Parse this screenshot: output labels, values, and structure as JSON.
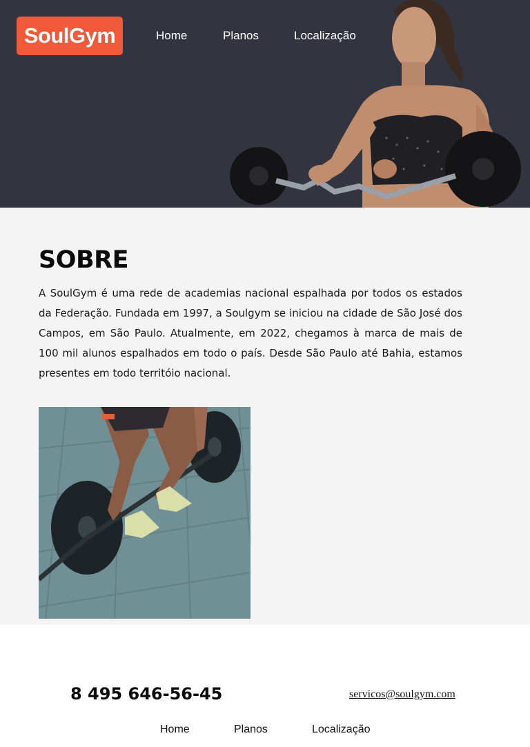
{
  "brand": {
    "logo_text": "SoulGym",
    "accent_color": "#f05a3a",
    "header_bg": "#32353f"
  },
  "nav": {
    "items": [
      {
        "label": "Home"
      },
      {
        "label": "Planos"
      },
      {
        "label": "Localização"
      }
    ]
  },
  "hero": {
    "image_icon": "woman-lifting-barbell-photo"
  },
  "about": {
    "title": "SOBRE",
    "body": "A SoulGym é uma rede de academias nacional espalhada por todos os estados da Federação. Fundada em 1997, a Soulgym se iniciou na cidade de São José dos Campos, em São Paulo. Atualmente, em 2022, chegamos à marca de mais de 100 mil alunos espalhados em todo o país. Desde São Paulo até Bahia, estamos presentes em todo territóio nacional.",
    "image_icon": "deadlift-barbell-photo",
    "bg": "#f4f4f4"
  },
  "footer": {
    "phone": "8 495 646-56-45",
    "email": "servicos@soulgym.com",
    "nav": [
      {
        "label": "Home"
      },
      {
        "label": "Planos"
      },
      {
        "label": "Localização"
      }
    ]
  }
}
